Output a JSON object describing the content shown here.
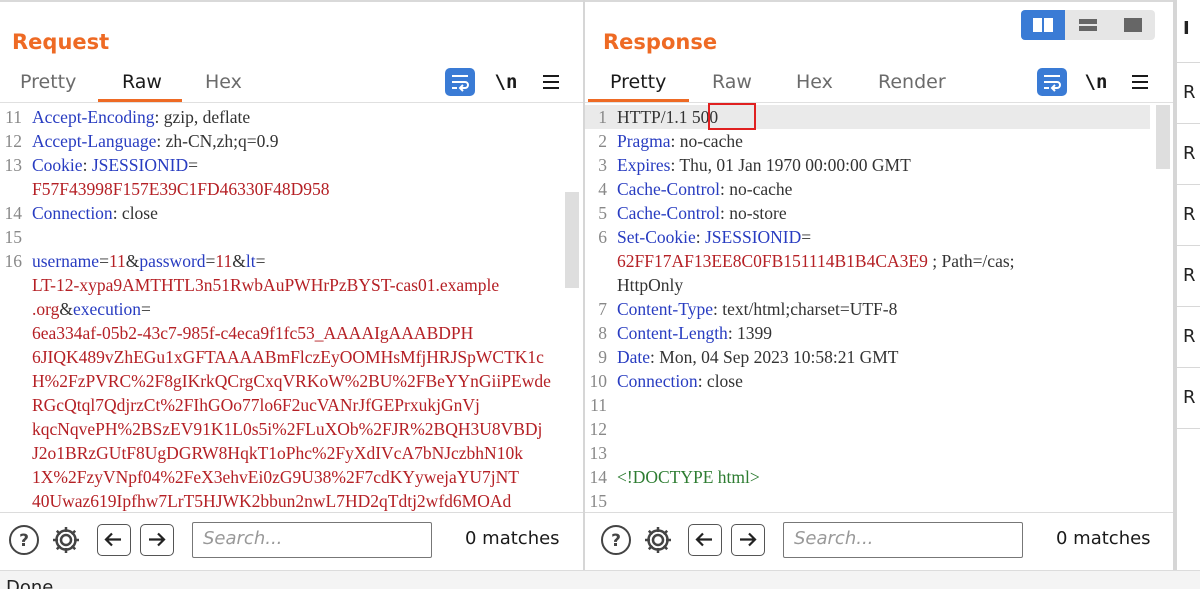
{
  "request": {
    "title": "Request",
    "tabs": [
      "Pretty",
      "Raw",
      "Hex"
    ],
    "active_tab": "Raw",
    "newline_toggle": "\\n",
    "lines": [
      {
        "n": "11",
        "segs": [
          [
            "k",
            "Accept-Encoding"
          ],
          [
            "v",
            ": gzip, deflate"
          ]
        ]
      },
      {
        "n": "12",
        "segs": [
          [
            "k",
            "Accept-Language"
          ],
          [
            "v",
            ": zh-CN,zh;q=0.9"
          ]
        ]
      },
      {
        "n": "13",
        "segs": [
          [
            "k",
            "Cookie"
          ],
          [
            "v",
            ": "
          ],
          [
            "k",
            "JSESSIONID"
          ],
          [
            "v",
            "="
          ]
        ]
      },
      {
        "n": "",
        "segs": [
          [
            "r",
            "F57F43998F157E39C1FD46330F48D958"
          ]
        ]
      },
      {
        "n": "14",
        "segs": [
          [
            "k",
            "Connection"
          ],
          [
            "v",
            ": close"
          ]
        ]
      },
      {
        "n": "15",
        "segs": []
      },
      {
        "n": "16",
        "segs": [
          [
            "k",
            "username"
          ],
          [
            "v",
            "="
          ],
          [
            "r",
            "11"
          ],
          [
            "v",
            "&"
          ],
          [
            "k",
            "password"
          ],
          [
            "v",
            "="
          ],
          [
            "r",
            "11"
          ],
          [
            "v",
            "&"
          ],
          [
            "k",
            "lt"
          ],
          [
            "v",
            "="
          ]
        ]
      },
      {
        "n": "",
        "segs": [
          [
            "r",
            "LT-12-xypa9AMTHTL3n51RwbAuPWHrPzBYST-cas01.example"
          ]
        ]
      },
      {
        "n": "",
        "segs": [
          [
            "r",
            ".org"
          ],
          [
            "v",
            "&"
          ],
          [
            "k",
            "execution"
          ],
          [
            "v",
            "="
          ]
        ]
      },
      {
        "n": "",
        "segs": [
          [
            "r",
            "6ea334af-05b2-43c7-985f-c4eca9f1fc53_AAAAIgAAABDPH"
          ]
        ]
      },
      {
        "n": "",
        "segs": [
          [
            "r",
            "6JIQK489vZhEGu1xGFTAAAABmFlczEyOOMHsMfjHRJSpWCTK1c"
          ]
        ]
      },
      {
        "n": "",
        "segs": [
          [
            "r",
            "H%2FzPVRC%2F8gIKrkQCrgCxqVRKoW%2BU%2FBeYYnGiiPEwde"
          ]
        ]
      },
      {
        "n": "",
        "segs": [
          [
            "r",
            "RGcQtql7QdjrzCt%2FIhGOo77lo6F2ucVANrJfGEPrxukjGnVj"
          ]
        ]
      },
      {
        "n": "",
        "segs": [
          [
            "r",
            "kqcNqvePH%2BSzEV91K1L0s5i%2FLuXOb%2FJR%2BQH3U8VBDj"
          ]
        ]
      },
      {
        "n": "",
        "segs": [
          [
            "r",
            "J2o1BRzGUtF8UgDGRW8HqkT1oPhc%2FyXdIVcA7bNJczbhN10k"
          ]
        ]
      },
      {
        "n": "",
        "segs": [
          [
            "r",
            "1X%2FzyVNpf04%2FeX3ehvEi0zG9U38%2F7cdKYywejaYU7jNT"
          ]
        ]
      },
      {
        "n": "",
        "segs": [
          [
            "r",
            "40Uwaz619Ipfhw7LrT5HJWK2bbun2nwL7HD2qTdtj2wfd6MOAd"
          ]
        ]
      }
    ],
    "search_placeholder": "Search...",
    "matches": "0 matches"
  },
  "response": {
    "title": "Response",
    "tabs": [
      "Pretty",
      "Raw",
      "Hex",
      "Render"
    ],
    "active_tab": "Pretty",
    "newline_toggle": "\\n",
    "lines": [
      {
        "n": "1",
        "segs": [
          [
            "v",
            "HTTP/1.1 "
          ],
          [
            "v",
            "500"
          ]
        ],
        "hl": true
      },
      {
        "n": "2",
        "segs": [
          [
            "k",
            "Pragma"
          ],
          [
            "v",
            ": no-cache"
          ]
        ]
      },
      {
        "n": "3",
        "segs": [
          [
            "k",
            "Expires"
          ],
          [
            "v",
            ": Thu, 01 Jan 1970 00:00:00 GMT"
          ]
        ]
      },
      {
        "n": "4",
        "segs": [
          [
            "k",
            "Cache-Control"
          ],
          [
            "v",
            ": no-cache"
          ]
        ]
      },
      {
        "n": "5",
        "segs": [
          [
            "k",
            "Cache-Control"
          ],
          [
            "v",
            ": no-store"
          ]
        ]
      },
      {
        "n": "6",
        "segs": [
          [
            "k",
            "Set-Cookie"
          ],
          [
            "v",
            ": "
          ],
          [
            "k",
            "JSESSIONID"
          ],
          [
            "v",
            "="
          ]
        ]
      },
      {
        "n": "",
        "segs": [
          [
            "r",
            "62FF17AF13EE8C0FB151114B1B4CA3E9"
          ],
          [
            "v",
            " ; Path=/cas;"
          ]
        ]
      },
      {
        "n": "",
        "segs": [
          [
            "v",
            "HttpOnly"
          ]
        ]
      },
      {
        "n": "7",
        "segs": [
          [
            "k",
            "Content-Type"
          ],
          [
            "v",
            ": text/html;charset=UTF-8"
          ]
        ]
      },
      {
        "n": "8",
        "segs": [
          [
            "k",
            "Content-Length"
          ],
          [
            "v",
            ": 1399"
          ]
        ]
      },
      {
        "n": "9",
        "segs": [
          [
            "k",
            "Date"
          ],
          [
            "v",
            ": Mon, 04 Sep 2023 10:58:21 GMT"
          ]
        ]
      },
      {
        "n": "10",
        "segs": [
          [
            "k",
            "Connection"
          ],
          [
            "v",
            ": close"
          ]
        ]
      },
      {
        "n": "11",
        "segs": []
      },
      {
        "n": "12",
        "segs": []
      },
      {
        "n": "13",
        "segs": []
      },
      {
        "n": "14",
        "segs": [
          [
            "g",
            "<!DOCTYPE html>"
          ]
        ]
      },
      {
        "n": "15",
        "segs": []
      }
    ],
    "search_placeholder": "Search...",
    "matches": "0 matches"
  },
  "inspector": {
    "title": "I",
    "items": [
      "R",
      "R",
      "R",
      "R",
      "R",
      "R"
    ]
  },
  "status_text": "Done",
  "colors": {
    "accent": "#ee6a24",
    "key": "#283cc1",
    "value_red": "#b52025",
    "button_blue": "#3a7bd5",
    "highlight_box": "#e02020"
  }
}
